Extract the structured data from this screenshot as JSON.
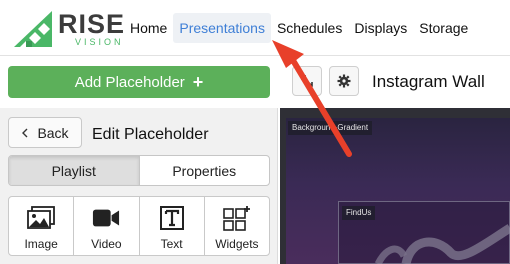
{
  "logo": {
    "word": "RISE",
    "sub": "VISION"
  },
  "nav": [
    {
      "label": "Home",
      "active": false
    },
    {
      "label": "Presentations",
      "active": true
    },
    {
      "label": "Schedules",
      "active": false
    },
    {
      "label": "Displays",
      "active": false
    },
    {
      "label": "Storage",
      "active": false
    }
  ],
  "toolbar": {
    "add_label": "Add Placeholder",
    "add_icon": "+",
    "presentation_title": "Instagram Wall"
  },
  "panel": {
    "back_label": "Back",
    "title": "Edit Placeholder",
    "tabs": [
      {
        "label": "Playlist",
        "active": true
      },
      {
        "label": "Properties",
        "active": false
      }
    ],
    "tiles": [
      {
        "label": "Image",
        "icon": "images-icon"
      },
      {
        "label": "Video",
        "icon": "video-camera-icon"
      },
      {
        "label": "Text",
        "icon": "text-icon"
      },
      {
        "label": "Widgets",
        "icon": "widgets-icon"
      }
    ]
  },
  "preview": {
    "placeholders": [
      "Background-Gradient",
      "FindUs"
    ]
  },
  "colors": {
    "brand_green": "#5cb05a",
    "nav_active": "#3f7fd6",
    "annotation_arrow": "#e8402a"
  }
}
